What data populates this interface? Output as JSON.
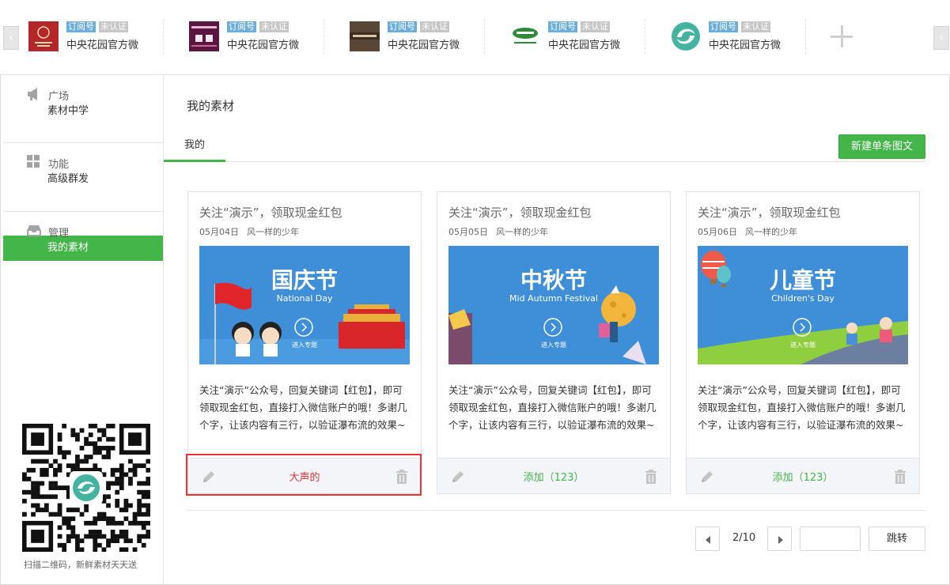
{
  "accounts": [
    {
      "type_badge": "订阅号",
      "status_badge": "未认证",
      "name": "中央花园官方微",
      "logo": "crest-logo-red"
    },
    {
      "type_badge": "订阅号",
      "status_badge": "未认证",
      "name": "中央花园官方微",
      "logo": "huahan-logo-purple"
    },
    {
      "type_badge": "订阅号",
      "status_badge": "未认证",
      "name": "中央花园官方微",
      "logo": "brown-banner-logo"
    },
    {
      "type_badge": "订阅号",
      "status_badge": "未认证",
      "name": "中央花园官方微",
      "logo": "green-text-logo"
    },
    {
      "type_badge": "订阅号",
      "status_badge": "未认证",
      "name": "中央花园官方微",
      "logo": "swirl-logo-green"
    }
  ],
  "sidebar": {
    "sections": [
      {
        "heading": "广场",
        "icon": "megaphone-icon",
        "items": [
          {
            "label": "素材中学"
          }
        ]
      },
      {
        "heading": "功能",
        "icon": "grid-icon",
        "items": [
          {
            "label": "高级群发"
          }
        ]
      },
      {
        "heading": "管理",
        "icon": "inbox-icon",
        "items": [
          {
            "label": "我的素材",
            "active": true
          }
        ]
      }
    ],
    "qr_caption": "扫描二维码，新鲜素材天天送"
  },
  "main": {
    "title": "我的素材",
    "tab": "我的",
    "new_button": "新建单条图文"
  },
  "cards": [
    {
      "title": "关注“演示”，领取现金红包",
      "date": "05月04日",
      "author": "风一样的少年",
      "cover_cn": "国庆节",
      "cover_en": "National Day",
      "cover_cta": "进入专题",
      "desc": "关注“演示”公众号，回复关键词【红包】，即可领取现金红包，直接打入微信账户的哦！多谢几个字，让该内容有三行，以验证瀑布流的效果~",
      "action": "大声的"
    },
    {
      "title": "关注“演示”，领取现金红包",
      "date": "05月05日",
      "author": "风一样的少年",
      "cover_cn": "中秋节",
      "cover_en": "Mid Autumn Festival",
      "cover_cta": "进入专题",
      "desc": "关注“演示”公众号，回复关键词【红包】，即可领取现金红包，直接打入微信账户的哦！多谢几个字，让该内容有三行，以验证瀑布流的效果~",
      "action": "添加（123）"
    },
    {
      "title": "关注“演示”，领取现金红包",
      "date": "05月06日",
      "author": "风一样的少年",
      "cover_cn": "儿童节",
      "cover_en": "Children's Day",
      "cover_cta": "进入专题",
      "desc": "关注“演示”公众号，回复关键词【红包】，即可领取现金红包，直接打入微信账户的哦！多谢几个字，让该内容有三行，以验证瀑布流的效果~",
      "action": "添加（123）"
    }
  ],
  "pager": {
    "current": "2/10",
    "input_value": "",
    "go_label": "跳转"
  },
  "colors": {
    "accent": "#44b549",
    "cover_blue": "#3d8fd8",
    "highlight": "#e33333"
  }
}
